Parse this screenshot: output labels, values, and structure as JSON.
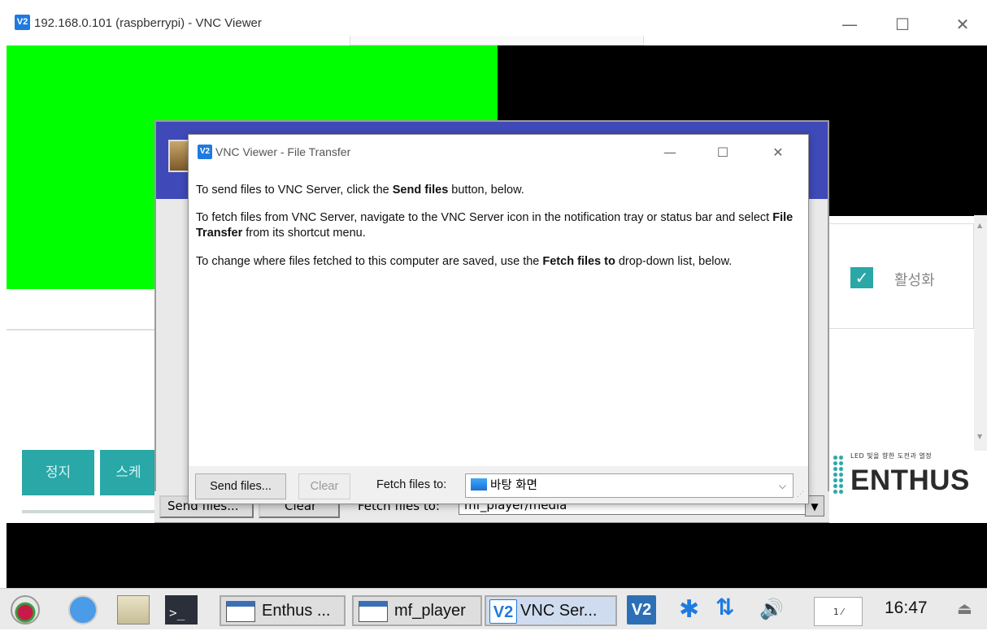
{
  "viewer": {
    "title": "192.168.0.101 (raspberrypi) - VNC Viewer",
    "badge": "V2"
  },
  "right_panel": {
    "checkbox_label": "활성화",
    "checked": true
  },
  "bottom_buttons": {
    "stop_label": "정지",
    "second_label": "스케"
  },
  "logo": {
    "tagline": "LED 빛을 향한 도전과 열정",
    "name": "ENTHUS"
  },
  "background_app": {
    "send_files_label": "Send files...",
    "clear_label": "Clear",
    "fetch_label": "Fetch files to:",
    "fetch_value": "mf_player/media"
  },
  "file_transfer": {
    "title": "VNC Viewer - File Transfer",
    "line1_prefix": "To send files to VNC Server, click the ",
    "line1_bold": "Send files",
    "line1_suffix": " button, below.",
    "line2_prefix": "To fetch files from VNC Server, navigate to the VNC Server icon in the notification tray or status bar and select ",
    "line2_bold": "File Transfer",
    "line2_suffix": " from its shortcut menu.",
    "line3_prefix": "To change where files fetched to this computer are saved, use the ",
    "line3_bold": "Fetch files to",
    "line3_suffix": " drop-down list, below.",
    "send_files_label": "Send files...",
    "clear_label": "Clear",
    "fetch_label": "Fetch files to:",
    "fetch_value": "바탕 화면"
  },
  "taskbar": {
    "tasks": [
      "Enthus ...",
      "mf_player",
      "VNC Ser..."
    ],
    "vnc_badge": "V2",
    "keyboard_indicator": "1 ⁄",
    "time": "16:47"
  },
  "colors": {
    "accent_teal": "#2aa7a7",
    "vnc_blue": "#1f7ae0",
    "green": "#00ff00",
    "app_title_blue": "#3f49b8"
  }
}
